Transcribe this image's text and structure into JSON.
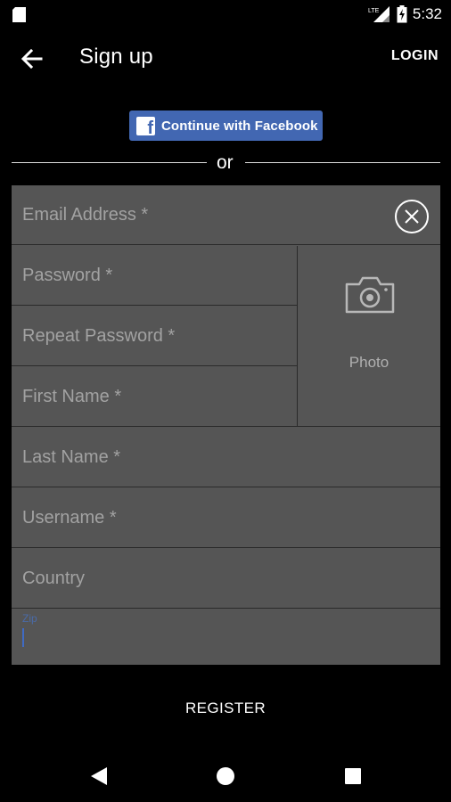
{
  "status_bar": {
    "time": "5:32",
    "network": "LTE",
    "icons": [
      "sd-card-icon",
      "lte-signal-icon",
      "battery-icon"
    ]
  },
  "toolbar": {
    "title": "Sign up",
    "login_label": "LOGIN",
    "back_icon": "arrow-left-icon"
  },
  "facebook": {
    "label": "Continue with Facebook",
    "icon": "facebook-icon",
    "color": "#4267b2"
  },
  "divider": {
    "text": "or"
  },
  "form": {
    "email_placeholder": "Email Address *",
    "password_placeholder": "Password *",
    "repeat_password_placeholder": "Repeat Password *",
    "first_name_placeholder": "First Name *",
    "last_name_placeholder": "Last Name *",
    "username_placeholder": "Username *",
    "country_placeholder": "Country",
    "zip_label": "Zip",
    "photo_label": "Photo",
    "photo_icon": "camera-icon",
    "clear_icon": "close-circle-icon"
  },
  "register_label": "REGISTER",
  "nav_bar": {
    "icons": [
      "nav-back-icon",
      "nav-home-icon",
      "nav-recent-icon"
    ]
  }
}
